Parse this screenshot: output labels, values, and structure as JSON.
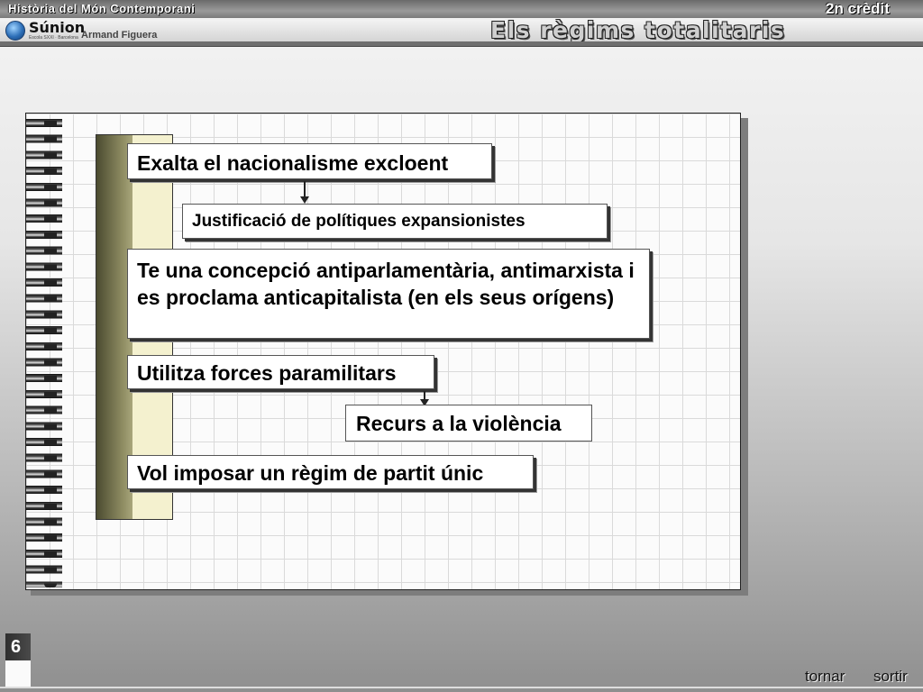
{
  "header": {
    "course_title": "Història del Món Contemporani",
    "credit": "2n crèdit",
    "logo_name": "Súnion",
    "logo_subtitle": "Escola SXXI · Barcelona",
    "author": "Armand Figuera",
    "slide_title": "Els règims totalitaris"
  },
  "content": {
    "boxes": [
      "Exalta el nacionalisme excloent",
      "Justificació de polítiques expansionistes",
      "Te una concepció antiparlamentària, antimarxista i es proclama anticapitalista (en els seus orígens)",
      "Utilitza forces paramilitars",
      "Recurs a la violència",
      "Vol imposar un règim de partit únic"
    ]
  },
  "footer": {
    "page_number": "6",
    "back_label": "tornar",
    "exit_label": "sortir"
  },
  "colors": {
    "header_bar": "#7a7a7a",
    "notebook_grid": "#dadada",
    "accent_olive": "#8f8d63",
    "accent_cream": "#f4f1cf"
  }
}
